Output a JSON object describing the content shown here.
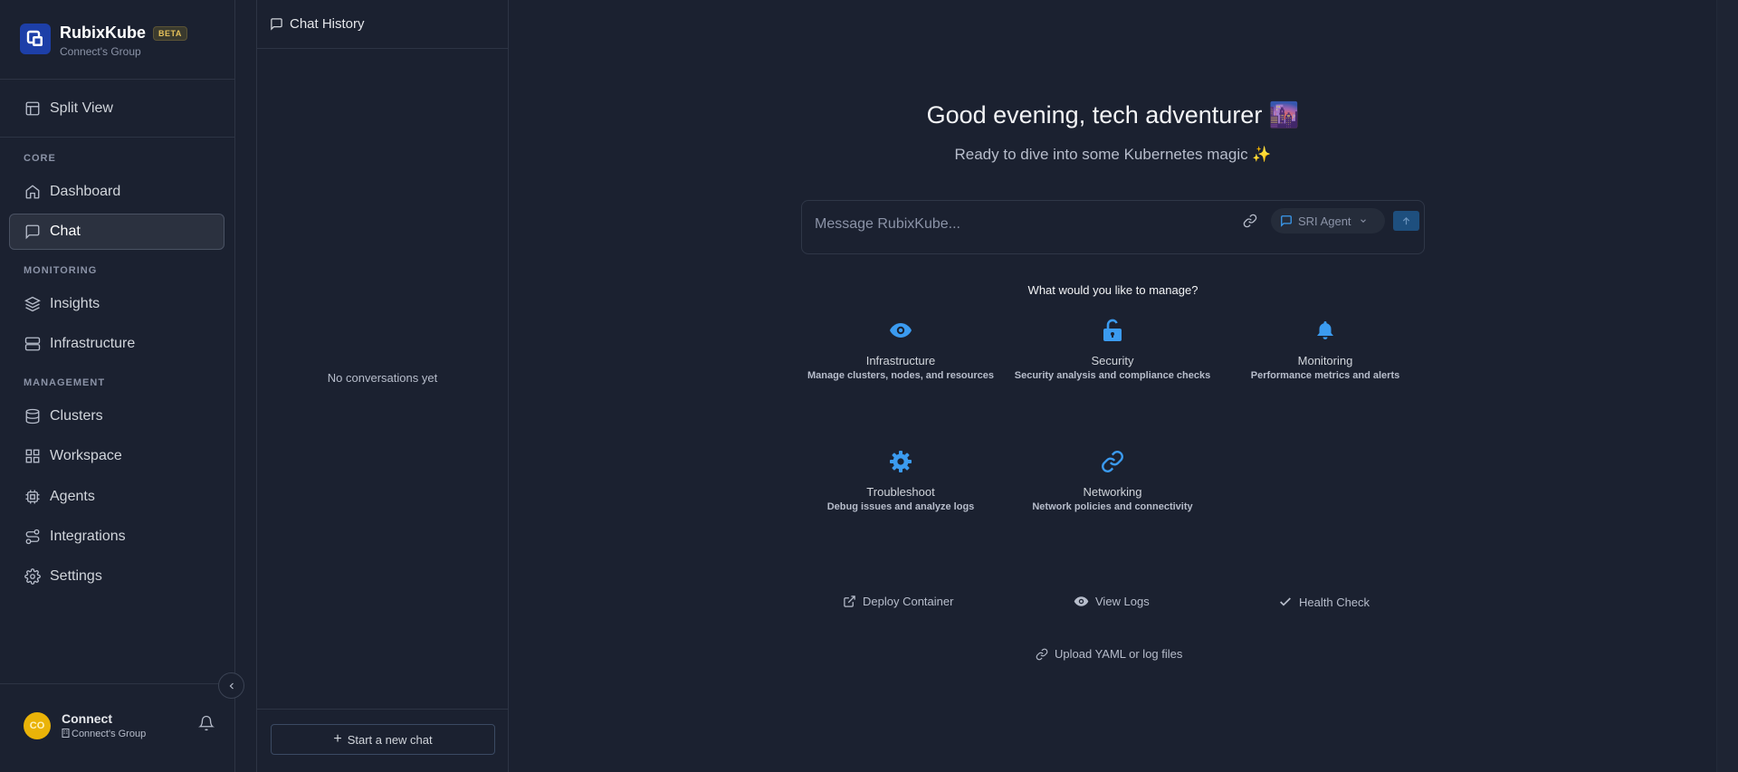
{
  "brand": {
    "name": "RubixKube",
    "badge": "BETA",
    "group": "Connect's Group"
  },
  "sidebar": {
    "split_view": "Split View",
    "sections": {
      "core": "CORE",
      "monitoring": "MONITORING",
      "management": "MANAGEMENT"
    },
    "items": [
      {
        "label": "Dashboard",
        "icon": "home-icon"
      },
      {
        "label": "Chat",
        "icon": "chat-icon",
        "active": true
      },
      {
        "label": "Insights",
        "icon": "layers-icon"
      },
      {
        "label": "Infrastructure",
        "icon": "server-icon"
      },
      {
        "label": "Clusters",
        "icon": "database-icon"
      },
      {
        "label": "Workspace",
        "icon": "grid-icon"
      },
      {
        "label": "Agents",
        "icon": "cpu-icon"
      },
      {
        "label": "Integrations",
        "icon": "route-icon"
      },
      {
        "label": "Settings",
        "icon": "gear-icon"
      }
    ]
  },
  "user": {
    "initials": "CO",
    "name": "Connect",
    "group": "Connect's Group"
  },
  "history": {
    "title": "Chat History",
    "empty": "No conversations yet",
    "new_chat": "Start a new chat"
  },
  "main": {
    "greeting": "Good evening, tech adventurer 🌆",
    "subtitle": "Ready to dive into some Kubernetes magic ✨",
    "input_placeholder": "Message RubixKube...",
    "agent": "SRI Agent",
    "manage_question": "What would you like to manage?",
    "cards": [
      {
        "title": "Infrastructure",
        "desc": "Manage clusters, nodes, and resources",
        "icon": "eye-icon"
      },
      {
        "title": "Security",
        "desc": "Security analysis and compliance checks",
        "icon": "lock-icon"
      },
      {
        "title": "Monitoring",
        "desc": "Performance metrics and alerts",
        "icon": "bell-icon"
      },
      {
        "title": "Troubleshoot",
        "desc": "Debug issues and analyze logs",
        "icon": "gear-icon"
      },
      {
        "title": "Networking",
        "desc": "Network policies and connectivity",
        "icon": "link-icon"
      }
    ],
    "quick_actions": [
      {
        "label": "Deploy Container",
        "icon": "external-link-icon"
      },
      {
        "label": "View Logs",
        "icon": "eye-icon"
      },
      {
        "label": "Health Check",
        "icon": "check-icon"
      }
    ],
    "upload": "Upload YAML or log files"
  },
  "colors": {
    "accent": "#3b9bf0",
    "background": "#1b2130",
    "active_nav": "#2b313f"
  }
}
